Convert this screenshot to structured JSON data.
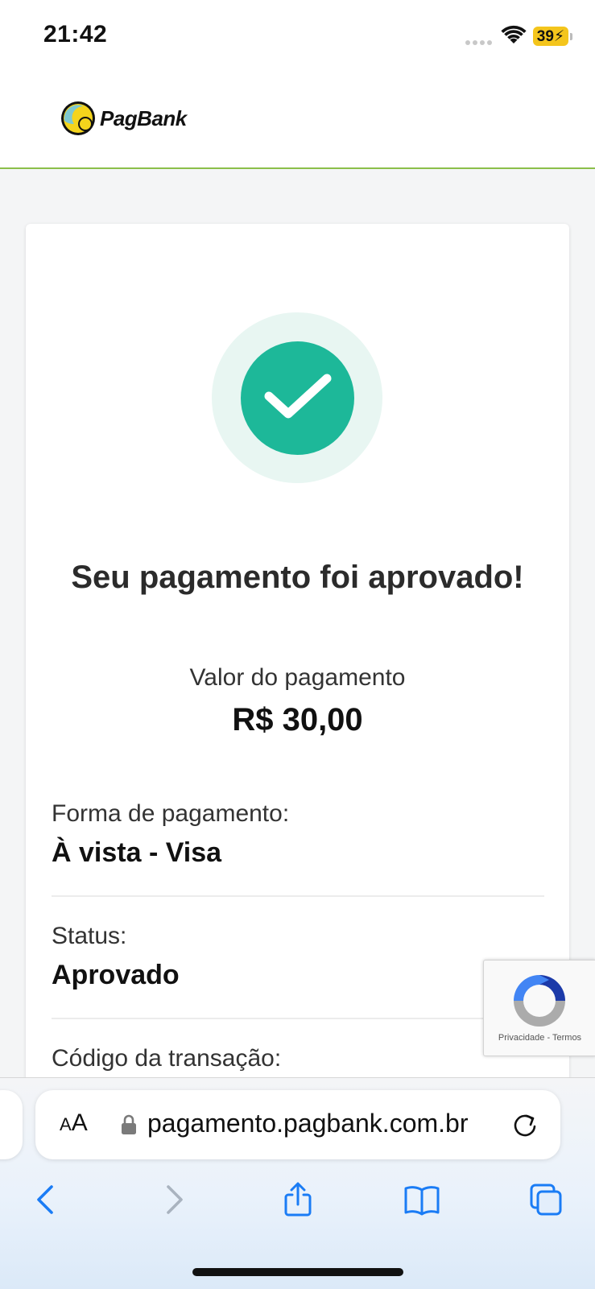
{
  "status_bar": {
    "time": "21:42",
    "battery": "39"
  },
  "header": {
    "logo_text": "PagBank"
  },
  "payment": {
    "title": "Seu pagamento foi aprovado!",
    "amount_label": "Valor do pagamento",
    "amount_value": "R$ 30,00",
    "fields": [
      {
        "label": "Forma de pagamento:",
        "value": "À vista - Visa"
      },
      {
        "label": "Status:",
        "value": "Aprovado"
      },
      {
        "label": "Código da transação:",
        "value": ""
      }
    ]
  },
  "recaptcha": {
    "privacy": "Privacidade",
    "separator": "-",
    "terms": "Termos"
  },
  "browser": {
    "aa_small": "A",
    "aa_large": "A",
    "url": "pagamento.pagbank.com.br",
    "icons": [
      "back-icon",
      "forward-icon",
      "share-icon",
      "bookmarks-icon",
      "tabs-icon"
    ]
  },
  "colors": {
    "success": "#1db899",
    "success_halo": "#e8f6f2",
    "header_rule": "#8bbf4a",
    "safari_blue": "#1a7cf5",
    "battery": "#f4c51c"
  }
}
